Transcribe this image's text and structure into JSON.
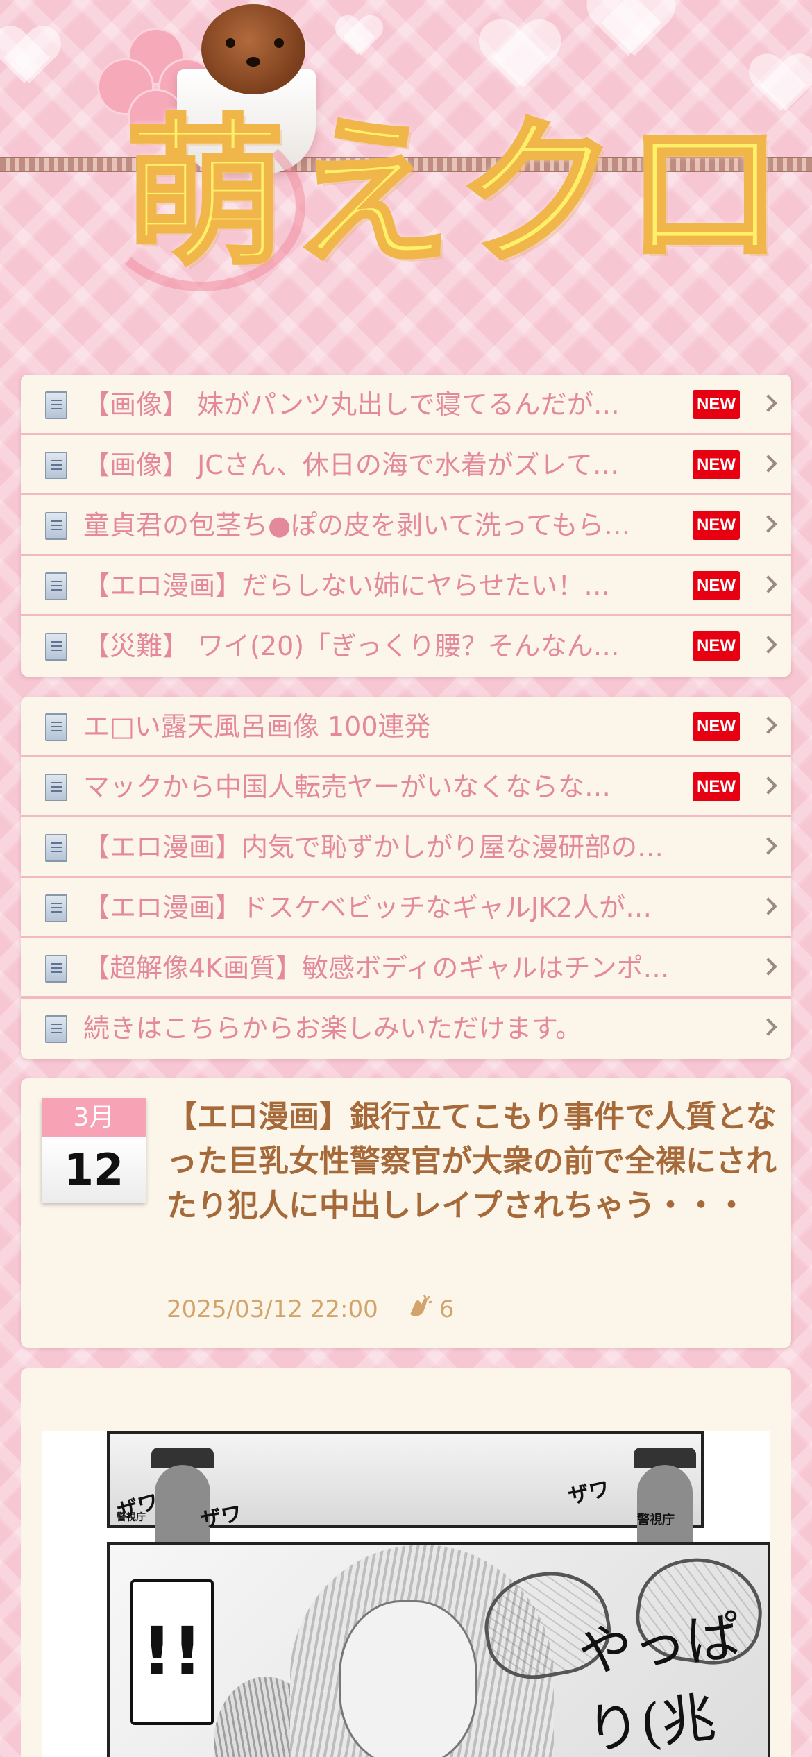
{
  "site": {
    "logo_text": "萌えクロ"
  },
  "colors": {
    "background": "#f7c6d3",
    "list_text": "#e4889c",
    "new_badge": "#e60012",
    "title": "#a66a3a",
    "meta": "#d2a46c"
  },
  "list_top": {
    "items": [
      {
        "label": "【画像】 妹がパンツ丸出しで寝てるんだが…",
        "new": "NEW"
      },
      {
        "label": "【画像】 JCさん、休日の海で水着がズレて…",
        "new": "NEW"
      },
      {
        "label": "童貞君の包茎ち●ぽの皮を剥いて洗ってもら…",
        "new": "NEW"
      },
      {
        "label": "【エロ漫画】だらしない姉にヤらせたい！…",
        "new": "NEW"
      },
      {
        "label": "【災難】 ワイ(20)「ぎっくり腰？そんなん…",
        "new": "NEW"
      }
    ]
  },
  "list_bottom": {
    "items": [
      {
        "label": "エ□い露天風呂画像 100連発",
        "new": "NEW"
      },
      {
        "label": "マックから中国人転売ヤーがいなくならな…",
        "new": "NEW"
      },
      {
        "label": "【エロ漫画】内気で恥ずかしがり屋な漫研部の…"
      },
      {
        "label": "【エロ漫画】ドスケベビッチなギャルJK2人が…"
      },
      {
        "label": "【超解像4K画質】敏感ボディのギャルはチンポ…"
      },
      {
        "label": "続きはこちらからお楽しみいただけます。"
      }
    ]
  },
  "article": {
    "month": "3月",
    "day": "12",
    "title": "【エロ漫画】銀行立てこもり事件で人質となった巨乳女性警察官が大衆の前で全裸にされたり犯人に中出しレイプされちゃう・・・",
    "datetime": "2025/03/12 22:00",
    "clap_icon": "clap-icon",
    "clap_count": "6"
  },
  "manga": {
    "sfx_1": "ザワ",
    "sfx_2": "ザワ",
    "sfx_3": "ザワ",
    "bubble": "!!",
    "speech": "やっぱり(兆",
    "badge_left": "警視庁",
    "badge_right": "警視庁"
  }
}
